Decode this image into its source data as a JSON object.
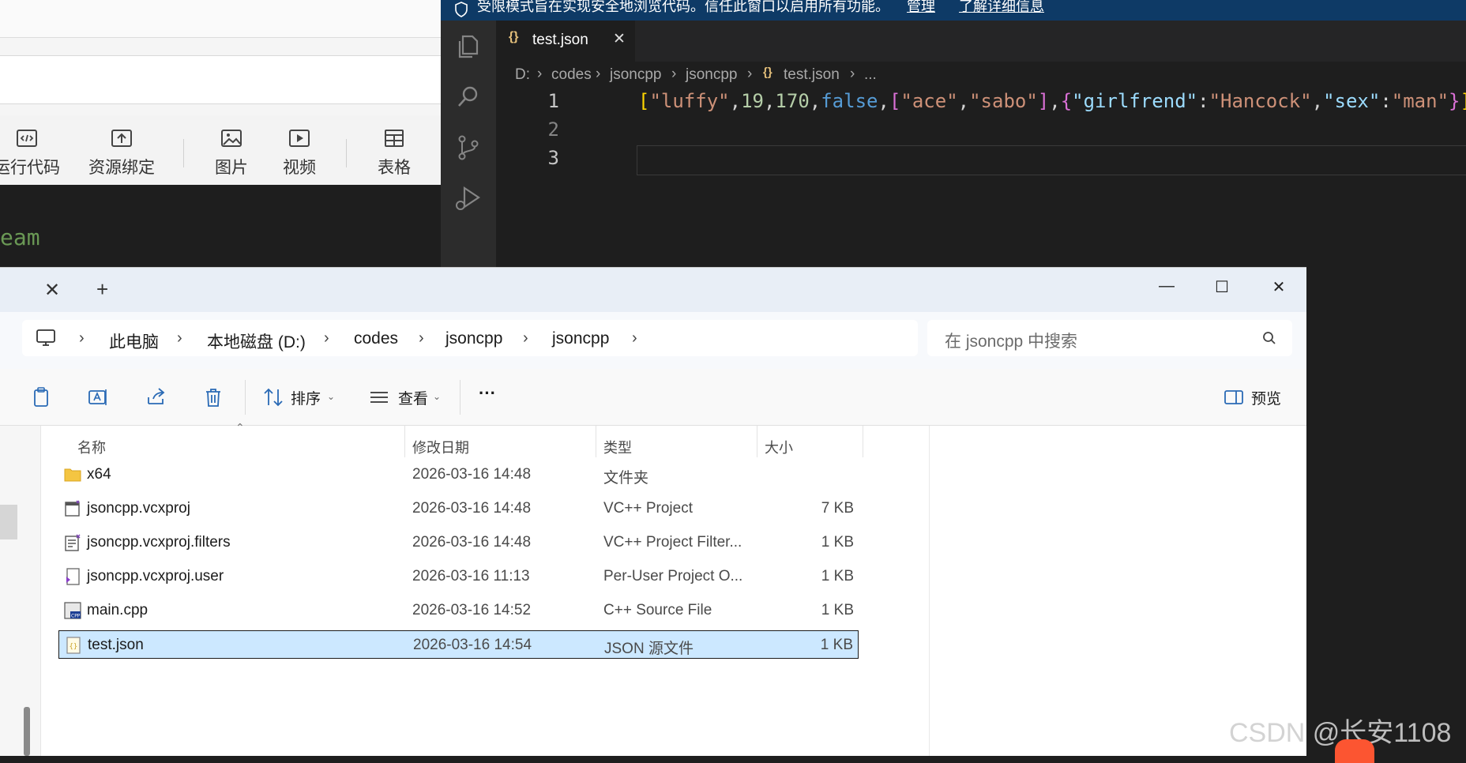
{
  "left_app": {
    "toolbar": [
      {
        "label": "运行代码",
        "icon": "code-icon"
      },
      {
        "label": "资源绑定",
        "icon": "upload-icon"
      },
      {
        "label": "图片",
        "icon": "image-icon"
      },
      {
        "label": "视频",
        "icon": "video-icon"
      },
      {
        "label": "表格",
        "icon": "table-icon"
      }
    ],
    "code_fragment": "eam"
  },
  "vscode": {
    "restricted_banner": {
      "text": "受限模式旨在实现安全地浏览代码。信任此窗口以启用所有功能。",
      "manage": "管理",
      "learn_more": "了解详细信息"
    },
    "tab": {
      "icon": "{}",
      "label": "test.json",
      "close": "✕"
    },
    "breadcrumb": [
      "D:",
      "codes",
      "jsoncpp",
      "jsoncpp",
      "test.json",
      "..."
    ],
    "line_numbers": [
      "1",
      "2",
      "3"
    ],
    "code_tokens": [
      {
        "t": "[",
        "c": "#ffd700"
      },
      {
        "t": "\"luffy\"",
        "c": "#ce9178"
      },
      {
        "t": ",",
        "c": "#d4d4d4"
      },
      {
        "t": "19",
        "c": "#b5cea8"
      },
      {
        "t": ",",
        "c": "#d4d4d4"
      },
      {
        "t": "170",
        "c": "#b5cea8"
      },
      {
        "t": ",",
        "c": "#d4d4d4"
      },
      {
        "t": "false",
        "c": "#569cd6"
      },
      {
        "t": ",",
        "c": "#d4d4d4"
      },
      {
        "t": "[",
        "c": "#da70d6"
      },
      {
        "t": "\"ace\"",
        "c": "#ce9178"
      },
      {
        "t": ",",
        "c": "#d4d4d4"
      },
      {
        "t": "\"sabo\"",
        "c": "#ce9178"
      },
      {
        "t": "]",
        "c": "#da70d6"
      },
      {
        "t": ",",
        "c": "#d4d4d4"
      },
      {
        "t": "{",
        "c": "#da70d6"
      },
      {
        "t": "\"girlfrend\"",
        "c": "#9cdcfe"
      },
      {
        "t": ":",
        "c": "#d4d4d4"
      },
      {
        "t": "\"Hancock\"",
        "c": "#ce9178"
      },
      {
        "t": ",",
        "c": "#d4d4d4"
      },
      {
        "t": "\"sex\"",
        "c": "#9cdcfe"
      },
      {
        "t": ":",
        "c": "#d4d4d4"
      },
      {
        "t": "\"man\"",
        "c": "#ce9178"
      },
      {
        "t": "}",
        "c": "#da70d6"
      },
      {
        "t": "]",
        "c": "#ffd700"
      }
    ]
  },
  "explorer": {
    "tab_close": "✕",
    "new_tab": "+",
    "window_buttons": {
      "minimize": "—",
      "maximize": "☐",
      "close": "✕"
    },
    "address": [
      "此电脑",
      "本地磁盘 (D:)",
      "codes",
      "jsoncpp",
      "jsoncpp"
    ],
    "search_placeholder": "在 jsoncpp 中搜索",
    "commands": {
      "sort": "排序",
      "view": "查看",
      "more": "···",
      "preview": "预览"
    },
    "columns": {
      "name": "名称",
      "date": "修改日期",
      "type": "类型",
      "size": "大小"
    },
    "files": [
      {
        "name": "x64",
        "date": "2026-03-16 14:48",
        "type": "文件夹",
        "size": "",
        "icon": "folder-icon"
      },
      {
        "name": "jsoncpp.vcxproj",
        "date": "2026-03-16 14:48",
        "type": "VC++ Project",
        "size": "7 KB",
        "icon": "vcxproj-icon"
      },
      {
        "name": "jsoncpp.vcxproj.filters",
        "date": "2026-03-16 14:48",
        "type": "VC++ Project Filter...",
        "size": "1 KB",
        "icon": "filters-icon"
      },
      {
        "name": "jsoncpp.vcxproj.user",
        "date": "2026-03-16 11:13",
        "type": "Per-User Project O...",
        "size": "1 KB",
        "icon": "user-file-icon"
      },
      {
        "name": "main.cpp",
        "date": "2026-03-16 14:52",
        "type": "C++ Source File",
        "size": "1 KB",
        "icon": "cpp-file-icon"
      },
      {
        "name": "test.json",
        "date": "2026-03-16 14:54",
        "type": "JSON 源文件",
        "size": "1 KB",
        "icon": "json-file-icon",
        "selected": true
      }
    ]
  },
  "watermark": "CSDN @长安1108"
}
